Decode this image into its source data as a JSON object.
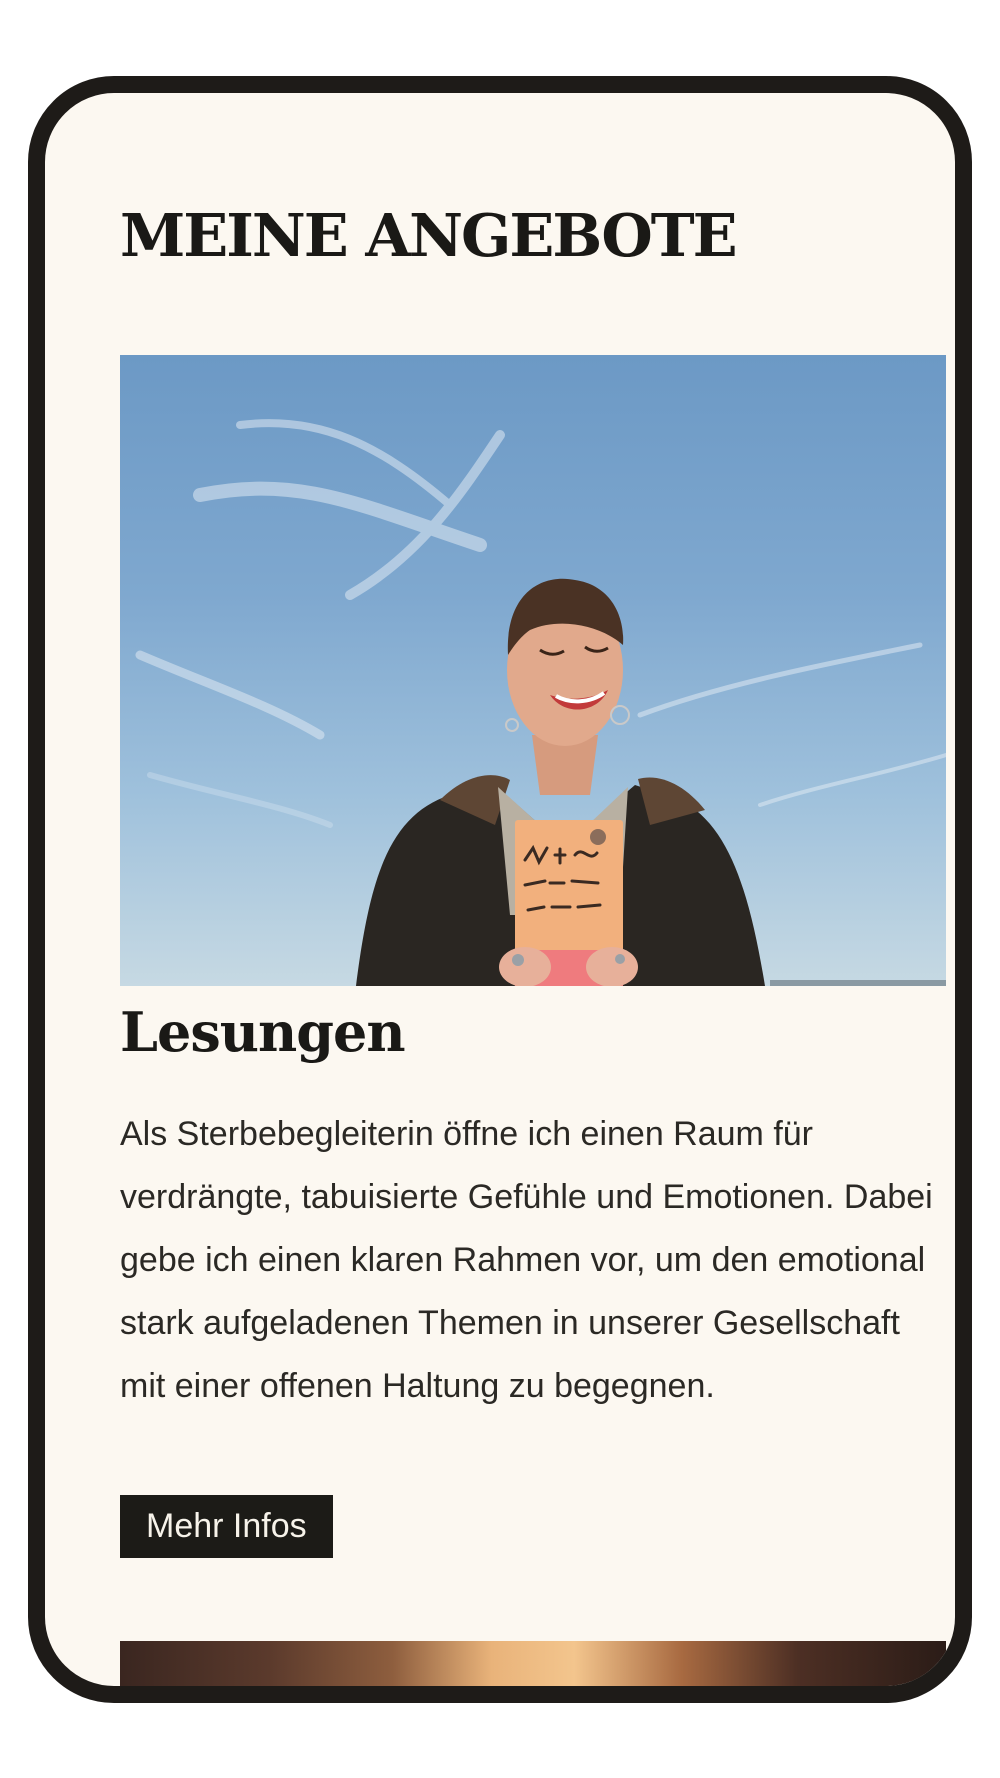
{
  "section": {
    "title": "MEINE ANGEBOTE"
  },
  "card": {
    "image": {
      "alt": "Lachende Frau hält ein Buch vor blauem Himmel",
      "icon": "photo-portrait"
    },
    "title": "Lesungen",
    "text": "Als Sterbebegleiterin öffne ich einen Raum für verdrängte, tabuisierte Gefühle und Emotionen. Dabei gebe ich einen klaren Rahmen vor, um den emotional stark aufgeladenen Themen in unserer Gesellschaft mit einer offenen Haltung zu begegnen.",
    "button_label": "Mehr Infos"
  },
  "next_card": {
    "image": {
      "alt": "Warm beleuchtetes Foto (teilweise sichtbar)",
      "icon": "photo-partial"
    }
  },
  "colors": {
    "background": "#fcf8f1",
    "frame": "#1e1b18",
    "text": "#1a1916",
    "button": "#1c1b17",
    "button_text": "#f7f3ea"
  }
}
